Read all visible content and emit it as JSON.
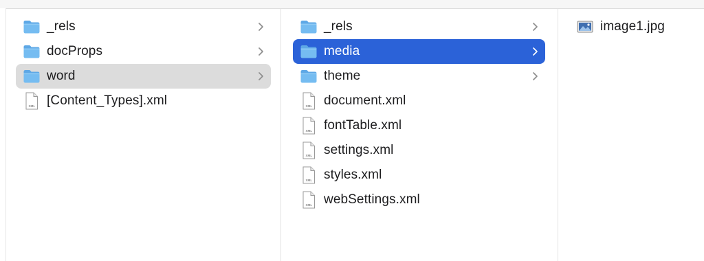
{
  "columns": {
    "col1": {
      "items": [
        {
          "label": "_rels",
          "kind": "folder",
          "icon": "folder-icon",
          "has_children": true
        },
        {
          "label": "docProps",
          "kind": "folder",
          "icon": "folder-icon",
          "has_children": true
        },
        {
          "label": "word",
          "kind": "folder",
          "icon": "folder-icon",
          "has_children": true,
          "selected": "inactive"
        },
        {
          "label": "[Content_Types].xml",
          "kind": "file",
          "icon": "xml-file-icon"
        }
      ]
    },
    "col2": {
      "items": [
        {
          "label": "_rels",
          "kind": "folder",
          "icon": "folder-icon",
          "has_children": true
        },
        {
          "label": "media",
          "kind": "folder",
          "icon": "folder-icon",
          "has_children": true,
          "selected": "active"
        },
        {
          "label": "theme",
          "kind": "folder",
          "icon": "folder-icon",
          "has_children": true
        },
        {
          "label": "document.xml",
          "kind": "file",
          "icon": "xml-file-icon"
        },
        {
          "label": "fontTable.xml",
          "kind": "file",
          "icon": "xml-file-icon"
        },
        {
          "label": "settings.xml",
          "kind": "file",
          "icon": "xml-file-icon"
        },
        {
          "label": "styles.xml",
          "kind": "file",
          "icon": "xml-file-icon"
        },
        {
          "label": "webSettings.xml",
          "kind": "file",
          "icon": "xml-file-icon"
        }
      ]
    },
    "col3": {
      "items": [
        {
          "label": "image1.jpg",
          "kind": "image",
          "icon": "image-file-icon"
        }
      ]
    }
  },
  "xml_badge": "XML",
  "colors": {
    "selection_active": "#2b62d8",
    "selection_inactive": "#dcdcdc",
    "folder": "#6fb6ee",
    "text": "#1d1d1f"
  }
}
